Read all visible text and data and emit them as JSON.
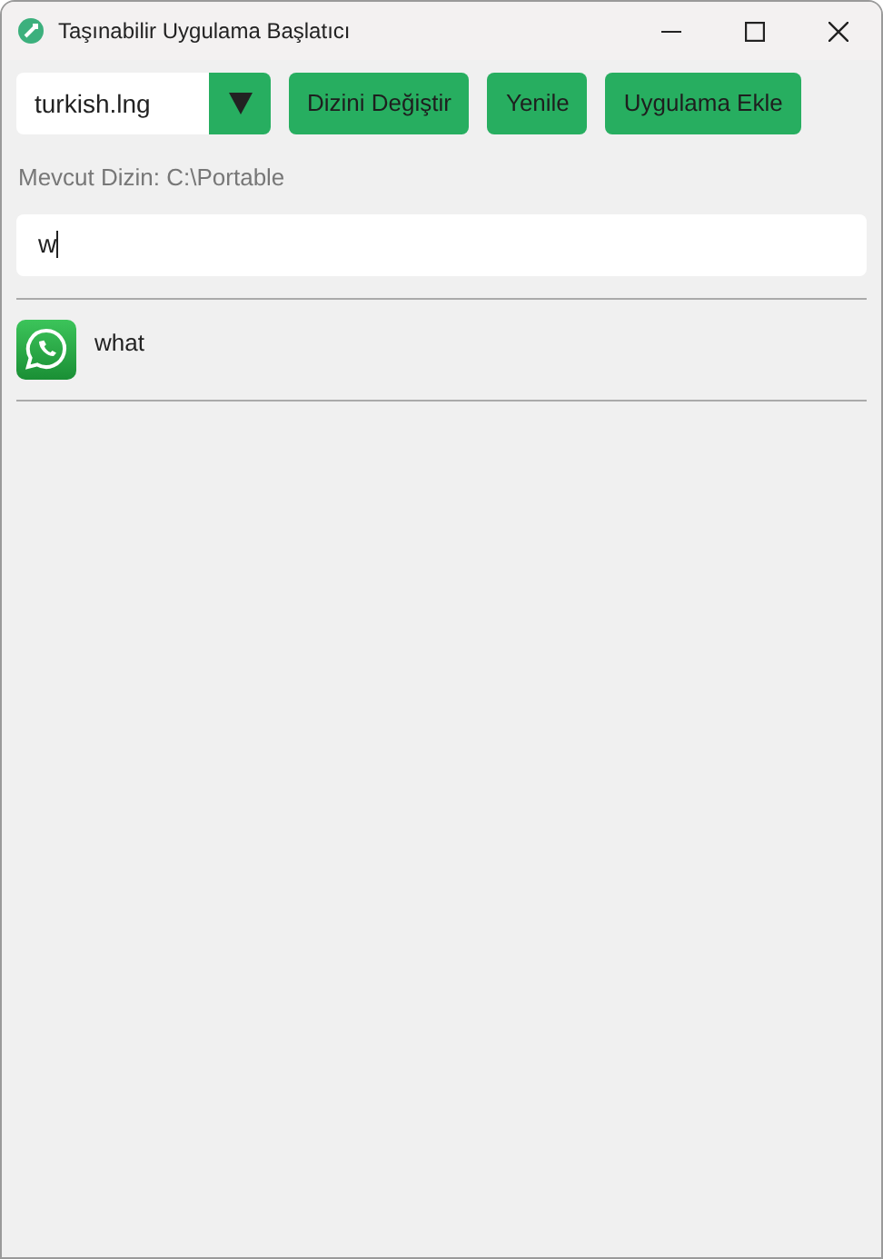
{
  "window": {
    "title": "Taşınabilir Uygulama Başlatıcı"
  },
  "toolbar": {
    "language": {
      "value": "turkish.lng"
    },
    "buttons": [
      "Dizini Değiştir",
      "Yenile",
      "Uygulama Ekle"
    ]
  },
  "current_dir": "Mevcut Dizin: C:\\Portable",
  "search": {
    "value": "w"
  },
  "apps": [
    {
      "name": "what"
    }
  ]
}
